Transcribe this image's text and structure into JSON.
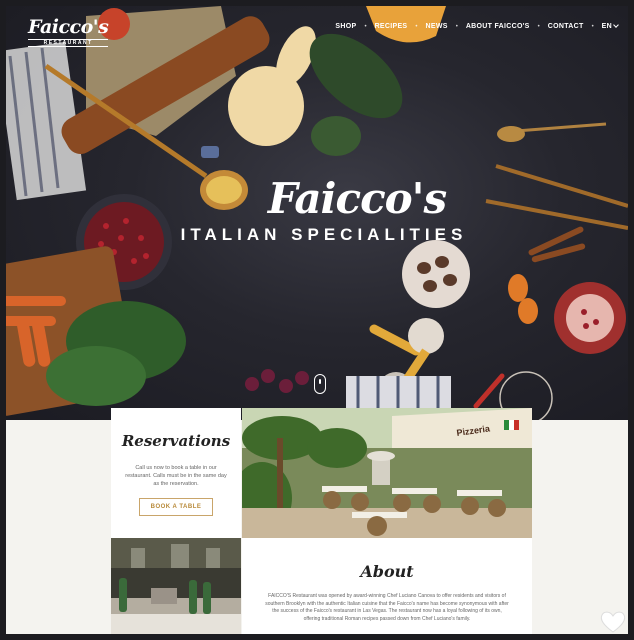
{
  "header": {
    "logo_text": "Faicco's",
    "logo_subtext": "RESTAURANT",
    "nav": [
      "SHOP",
      "RECIPES",
      "NEWS",
      "ABOUT FAICCO'S",
      "CONTACT"
    ],
    "language": "EN"
  },
  "hero": {
    "brand": "Faicco's",
    "tagline": "ITALIAN SPECIALITIES"
  },
  "reservations": {
    "title": "Reservations",
    "text": "Call us now to book a table in our restaurant. Calls must be in the same day as the reservation.",
    "button": "BOOK A TABLE"
  },
  "photo": {
    "sign": "Pizzeria"
  },
  "about": {
    "title": "About",
    "text": "FAICCO'S Restaurant was opened by award-winning Chef Luciano Canova to offer residents and visitors of southern Brooklyn with the authentic Italian cuisine that the Faicco's name has become synonymous with after the success of the Faicco's restaurant in Las Vegas. The restaurant now has a loyal following of its own, offering traditional Roman recipes passed down from Chef Luciano's family."
  },
  "colors": {
    "accent_gold": "#c9a56a",
    "hero_background": "#26262e"
  }
}
